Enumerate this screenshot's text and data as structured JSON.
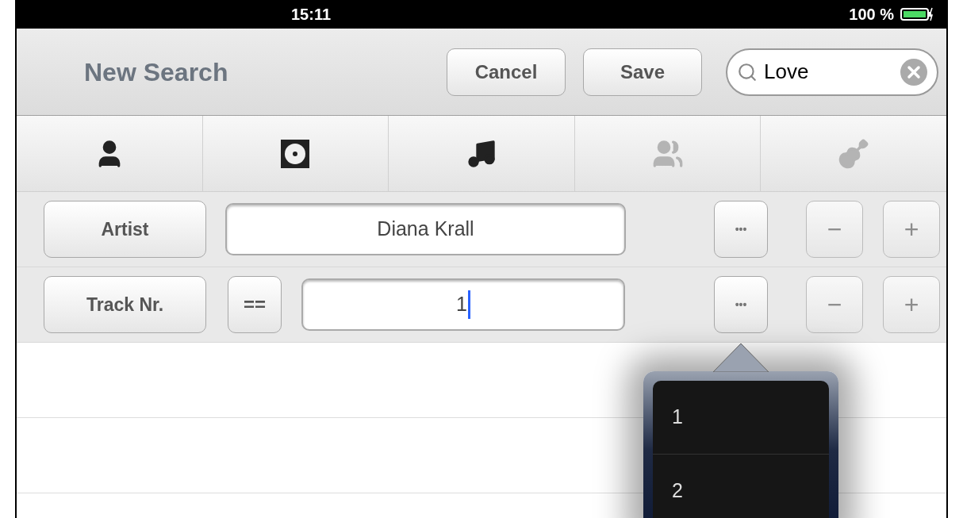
{
  "status_bar": {
    "time": "15:11",
    "battery": "100 %"
  },
  "header": {
    "title": "New Search",
    "buttons": [
      "Cancel",
      "Save"
    ],
    "search": {
      "value": "Love"
    }
  },
  "tabs": [
    {
      "kind": "person",
      "disabled": false
    },
    {
      "kind": "disc",
      "disabled": false
    },
    {
      "kind": "note",
      "disabled": false
    },
    {
      "kind": "group",
      "disabled": true
    },
    {
      "kind": "guitar",
      "disabled": true
    }
  ],
  "criteria": [
    {
      "kind": "text",
      "field": "Artist",
      "value": "Diana Krall",
      "more": "•••",
      "remove": "−",
      "add": "+"
    },
    {
      "kind": "compare",
      "field": "Track Nr.",
      "operator": "==",
      "value": "1",
      "focused": true,
      "more": "•••",
      "remove": "−",
      "add": "+"
    }
  ],
  "popover": {
    "items": [
      "1",
      "2"
    ]
  }
}
